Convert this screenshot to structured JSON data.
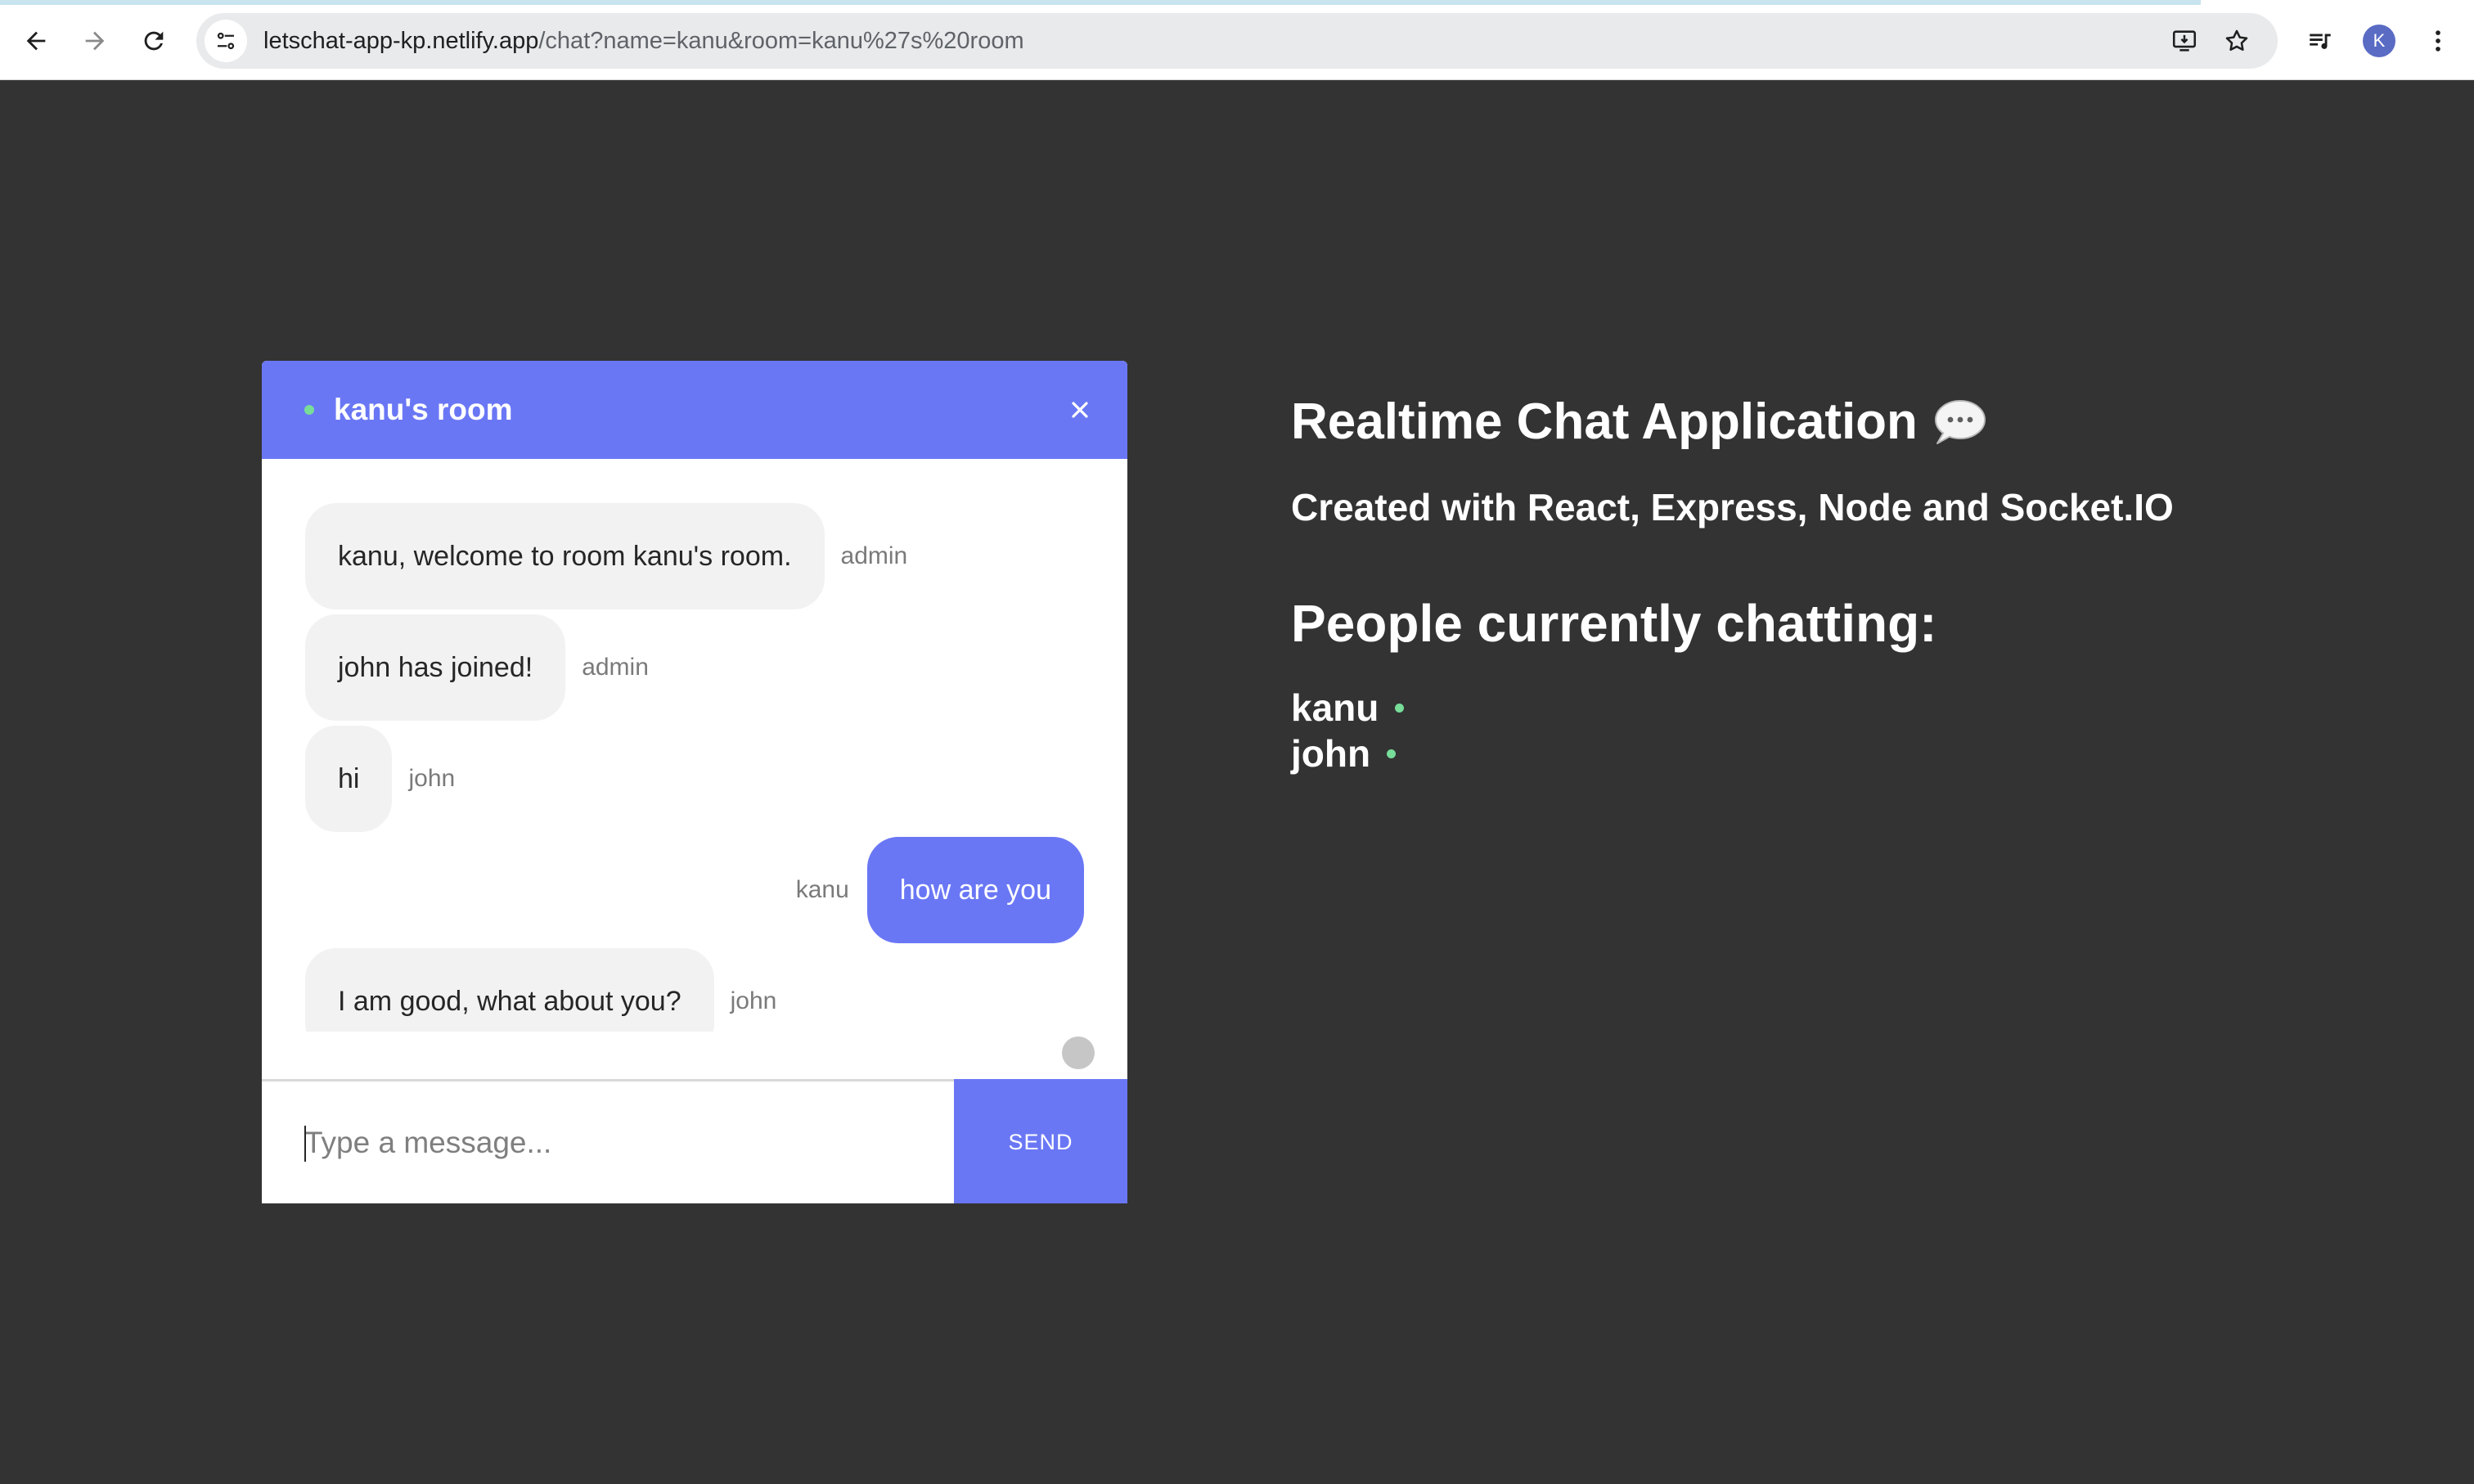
{
  "browser": {
    "url_host": "letschat-app-kp.netlify.app",
    "url_path": "/chat?name=kanu&room=kanu%27s%20room",
    "profile_initial": "K"
  },
  "chat": {
    "room_name": "kanu's room",
    "messages": [
      {
        "text": "kanu, welcome to room kanu's room.",
        "sender": "admin",
        "side": "left"
      },
      {
        "text": "john has joined!",
        "sender": "admin",
        "side": "left"
      },
      {
        "text": "hi",
        "sender": "john",
        "side": "left"
      },
      {
        "text": "how are you",
        "sender": "kanu",
        "side": "right"
      },
      {
        "text": "I am good, what about you?",
        "sender": "john",
        "side": "left"
      }
    ],
    "input_placeholder": "Type a message...",
    "send_label": "SEND"
  },
  "info": {
    "title": "Realtime Chat Application",
    "subtitle": "Created with React, Express, Node and Socket.IO",
    "people_heading": "People currently chatting:",
    "people": [
      "kanu",
      "john"
    ]
  },
  "colors": {
    "accent": "#6a77f5",
    "background": "#333333",
    "online": "#77dd99"
  }
}
